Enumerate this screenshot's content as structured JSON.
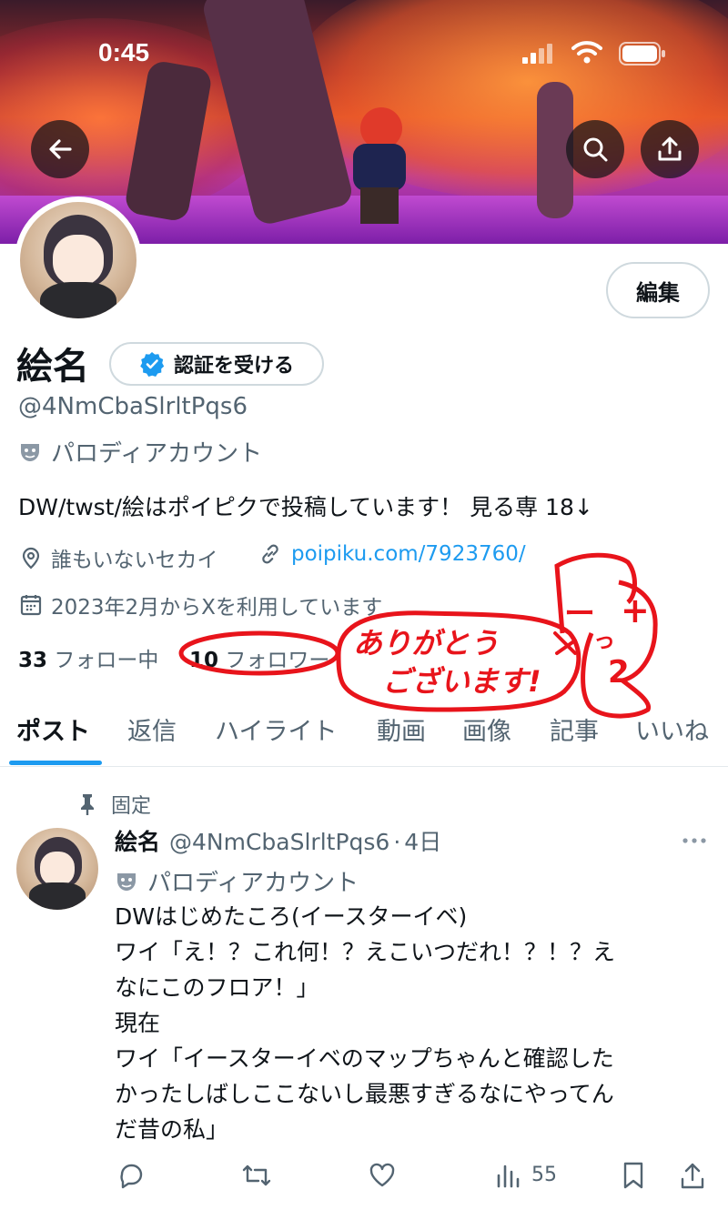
{
  "status_bar": {
    "time": "0:45"
  },
  "profile": {
    "name": "絵名",
    "verify_label": "認証を受ける",
    "edit_label": "編集",
    "handle": "@4NmCbaSlrltPqs6",
    "account_label": "パロディアカウント",
    "bio": "DW/twst/絵はポイピクで投稿しています！ 見る専 18↓",
    "location": "誰もいないセカイ",
    "website": "poipiku.com/7923760/",
    "joined": "2023年2月からXを利用しています",
    "following_count": "33",
    "following_label": "フォロー中",
    "followers_count": "10",
    "followers_label": "フォロワー"
  },
  "annotation": {
    "message_line1": "ありがとう",
    "message_line2": "ございます!",
    "glyph1": "ー",
    "glyph2": "+",
    "glyph3": "っ",
    "glyph4": "2",
    "color": "#e8141b"
  },
  "tabs": [
    {
      "label": "ポスト",
      "active": true
    },
    {
      "label": "返信"
    },
    {
      "label": "ハイライト"
    },
    {
      "label": "動画"
    },
    {
      "label": "画像"
    },
    {
      "label": "記事"
    },
    {
      "label": "いいね"
    }
  ],
  "post": {
    "pinned_label": "固定",
    "author_name": "絵名",
    "author_handle": "@4NmCbaSlrltPqs6",
    "separator": "·",
    "time": "4日",
    "account_label": "パロディアカウント",
    "text": "DWはじめたころ(イースターイベ)\nワイ「え！？これ何！？えこいつだれ！？！？え\nなにこのフロア！」\n現在\nワイ「イースターイベのマップちゃんと確認した\nかったしばしここないし最悪すぎるなにやってん\nだ昔の私」",
    "views": "55"
  },
  "colors": {
    "accent": "#1d9bf0",
    "text": "#0f1419",
    "secondary": "#536471"
  },
  "icons": [
    "back-arrow-icon",
    "search-icon",
    "share-icon",
    "verified-badge-icon",
    "parody-mask-icon",
    "location-pin-icon",
    "link-icon",
    "calendar-icon",
    "pin-icon",
    "more-icon",
    "reply-icon",
    "repost-icon",
    "like-icon",
    "views-icon",
    "bookmark-icon",
    "share-icon"
  ]
}
